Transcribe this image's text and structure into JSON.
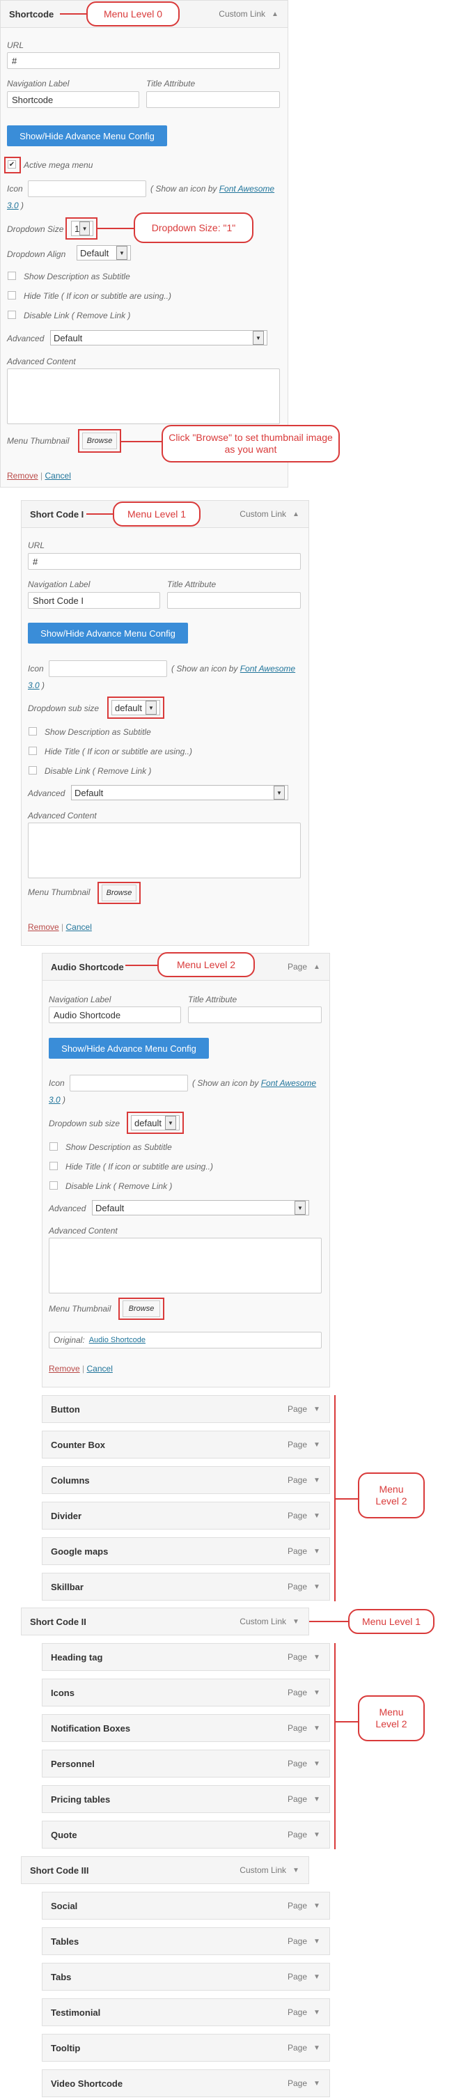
{
  "colors": {
    "accent_blue": "#3a8dd8",
    "annotation_red": "#d93a3a",
    "remove_red": "#b94a48",
    "link_blue": "#21759b"
  },
  "level0": {
    "title": "Shortcode",
    "type": "Custom Link",
    "url_label": "URL",
    "url_value": "#",
    "nav_label": "Navigation Label",
    "nav_value": "Shortcode",
    "title_attr_label": "Title Attribute",
    "config_button": "Show/Hide Advance Menu Config",
    "active_mega": "Active mega menu",
    "icon_label": "Icon",
    "icon_hint": "( Show an icon by ",
    "icon_link": "Font Awesome",
    "icon_version": "3.0",
    "icon_close": " )",
    "dropdown_size_label": "Dropdown Size",
    "dropdown_size_value": "1",
    "dropdown_align_label": "Dropdown Align",
    "dropdown_align_value": "Default",
    "show_desc": "Show Description as Subtitle",
    "hide_title": "Hide Title ( If icon or subtitle are using..)",
    "disable_link": "Disable Link ( Remove Link )",
    "advanced_label": "Advanced",
    "advanced_value": "Default",
    "advanced_content": "Advanced Content",
    "thumb_label": "Menu Thumbnail",
    "browse": "Browse",
    "remove": "Remove",
    "sep": "|",
    "cancel": "Cancel"
  },
  "level1": {
    "title": "Short Code I",
    "type": "Custom Link",
    "url_label": "URL",
    "url_value": "#",
    "nav_label": "Navigation Label",
    "nav_value": "Short Code I",
    "title_attr_label": "Title Attribute",
    "config_button": "Show/Hide Advance Menu Config",
    "icon_label": "Icon",
    "icon_hint": "( Show an icon by ",
    "icon_link": "Font Awesome",
    "icon_version": "3.0",
    "icon_close": " )",
    "dropdown_sub_label": "Dropdown sub size",
    "dropdown_sub_value": "default",
    "show_desc": "Show Description as Subtitle",
    "hide_title": "Hide Title ( If icon or subtitle are using..)",
    "disable_link": "Disable Link ( Remove Link )",
    "advanced_label": "Advanced",
    "advanced_value": "Default",
    "advanced_content": "Advanced Content",
    "thumb_label": "Menu Thumbnail",
    "browse": "Browse",
    "remove": "Remove",
    "sep": "|",
    "cancel": "Cancel"
  },
  "level2": {
    "title": "Audio Shortcode",
    "type": "Page",
    "nav_label": "Navigation Label",
    "nav_value": "Audio Shortcode",
    "title_attr_label": "Title Attribute",
    "config_button": "Show/Hide Advance Menu Config",
    "icon_label": "Icon",
    "icon_hint": "( Show an icon by ",
    "icon_link": "Font Awesome",
    "icon_version": "3.0",
    "icon_close": " )",
    "dropdown_sub_label": "Dropdown sub size",
    "dropdown_sub_value": "default",
    "show_desc": "Show Description as Subtitle",
    "hide_title": "Hide Title ( If icon or subtitle are using..)",
    "disable_link": "Disable Link ( Remove Link )",
    "advanced_label": "Advanced",
    "advanced_value": "Default",
    "advanced_content": "Advanced Content",
    "thumb_label": "Menu Thumbnail",
    "browse": "Browse",
    "original_label": "Original:",
    "original_link": "Audio Shortcode",
    "remove": "Remove",
    "sep": "|",
    "cancel": "Cancel"
  },
  "group1_items": [
    {
      "title": "Button",
      "type": "Page"
    },
    {
      "title": "Counter Box",
      "type": "Page"
    },
    {
      "title": "Columns",
      "type": "Page"
    },
    {
      "title": "Divider",
      "type": "Page"
    },
    {
      "title": "Google maps",
      "type": "Page"
    },
    {
      "title": "Skillbar",
      "type": "Page"
    }
  ],
  "short_code_ii": {
    "title": "Short Code II",
    "type": "Custom Link"
  },
  "group2_items": [
    {
      "title": "Heading tag",
      "type": "Page"
    },
    {
      "title": "Icons",
      "type": "Page"
    },
    {
      "title": "Notification Boxes",
      "type": "Page"
    },
    {
      "title": "Personnel",
      "type": "Page"
    },
    {
      "title": "Pricing tables",
      "type": "Page"
    },
    {
      "title": "Quote",
      "type": "Page"
    }
  ],
  "short_code_iii": {
    "title": "Short Code III",
    "type": "Custom Link"
  },
  "group3_items": [
    {
      "title": "Social",
      "type": "Page"
    },
    {
      "title": "Tables",
      "type": "Page"
    },
    {
      "title": "Tabs",
      "type": "Page"
    },
    {
      "title": "Testimonial",
      "type": "Page"
    },
    {
      "title": "Tooltip",
      "type": "Page"
    },
    {
      "title": "Video Shortcode",
      "type": "Page"
    }
  ],
  "annotations": {
    "menu_level_0": "Menu Level 0",
    "dropdown_size": "Dropdown Size: \"1\"",
    "browse_note": "Click \"Browse\" to set thumbnail image as you want",
    "menu_level_1": "Menu Level 1",
    "menu_level_2": "Menu Level 2",
    "menu_level_1b": "Menu Level 1",
    "menu_level_2_group1": "Menu Level 2",
    "menu_level_2_group2": "Menu Level 2"
  }
}
